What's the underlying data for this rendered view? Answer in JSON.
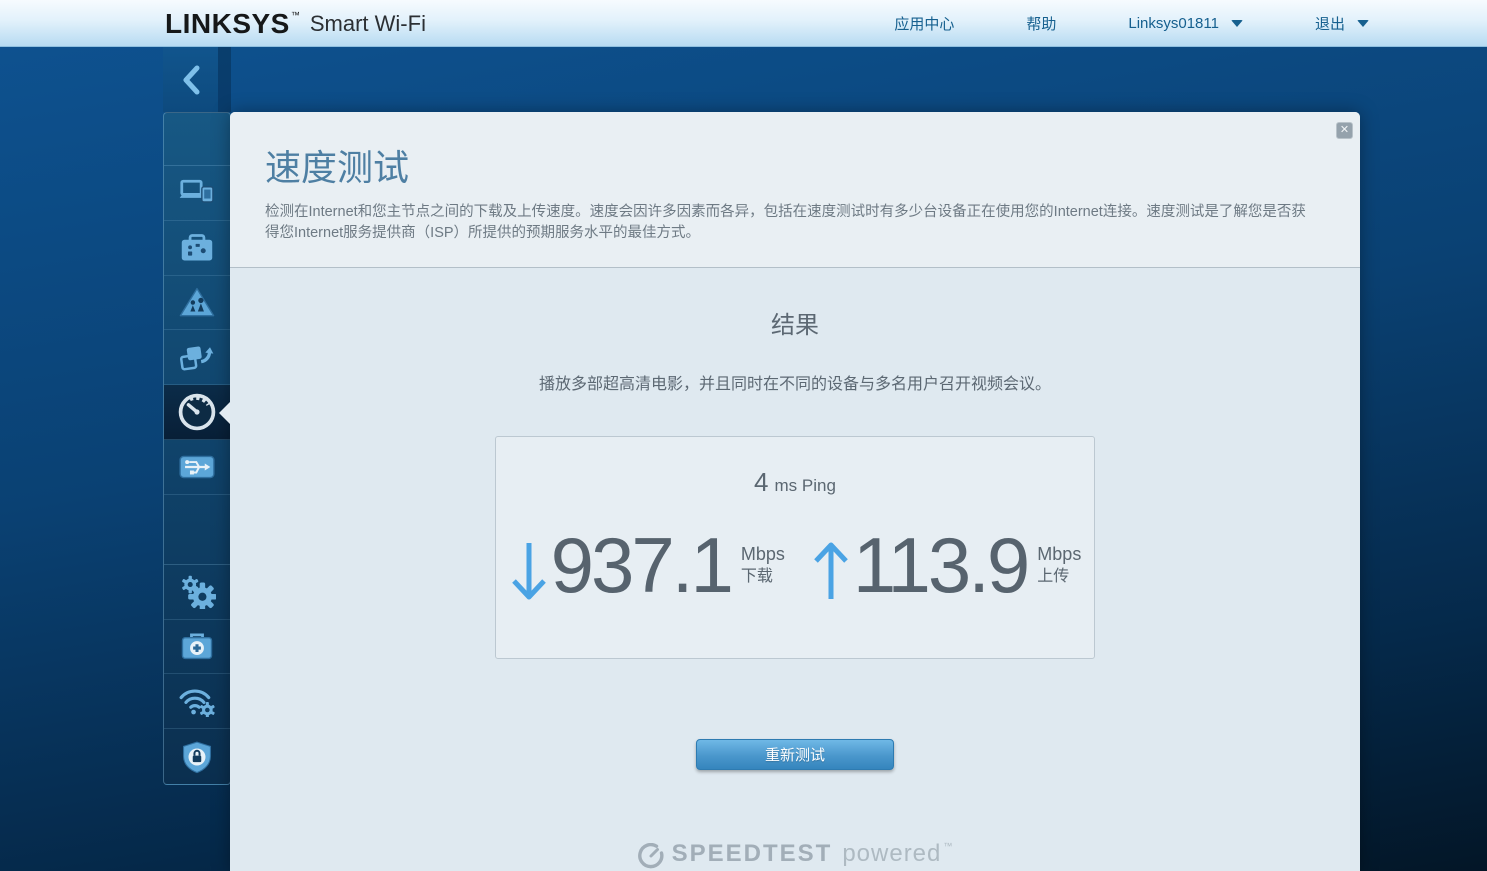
{
  "header": {
    "brand": "LINKSYS",
    "brand_tm": "™",
    "brand_suffix": "Smart Wi-Fi",
    "nav": [
      {
        "label": "应用中心",
        "dropdown": false
      },
      {
        "label": "帮助",
        "dropdown": false
      },
      {
        "label": "Linksys01811",
        "dropdown": true
      },
      {
        "label": "退出",
        "dropdown": true
      }
    ]
  },
  "sidebar": {
    "collapse_icon": "chevron-left",
    "items": [
      {
        "icon": "devices-icon",
        "active": false
      },
      {
        "icon": "guest-access-icon",
        "active": false
      },
      {
        "icon": "parental-controls-icon",
        "active": false
      },
      {
        "icon": "media-prioritization-icon",
        "active": false
      },
      {
        "icon": "speed-test-icon",
        "active": true
      },
      {
        "icon": "external-storage-icon",
        "active": false
      },
      {
        "icon": "connectivity-icon",
        "active": false
      },
      {
        "icon": "troubleshooting-icon",
        "active": false
      },
      {
        "icon": "wireless-icon",
        "active": false
      },
      {
        "icon": "security-icon",
        "active": false
      }
    ]
  },
  "modal": {
    "close_label": "✕",
    "title": "速度测试",
    "description": "检测在Internet和您主节点之间的下载及上传速度。速度会因许多因素而各异，包括在速度测试时有多少台设备正在使用您的Internet连接。速度测试是了解您是否获得您Internet服务提供商（ISP）所提供的预期服务水平的最佳方式。",
    "results_heading": "结果",
    "results_subtitle": "播放多部超高清电影，并且同时在不同的设备与多名用户召开视频会议。",
    "ping": {
      "value": "4",
      "unit": "ms Ping"
    },
    "download": {
      "value": "937.1",
      "unit": "Mbps",
      "label": "下载",
      "direction": "down"
    },
    "upload": {
      "value": "113.9",
      "unit": "Mbps",
      "label": "上传",
      "direction": "up"
    },
    "retest_button": "重新测试",
    "branding": {
      "name": "SPEEDTEST",
      "powered": "powered",
      "tm": "™"
    }
  },
  "colors": {
    "accent_blue": "#4aa3e4",
    "title_blue": "#4e7fa3",
    "number_gray": "#57636e",
    "button_blue": "#4593c9",
    "sidebar_icon_blue": "#6cb0de"
  }
}
